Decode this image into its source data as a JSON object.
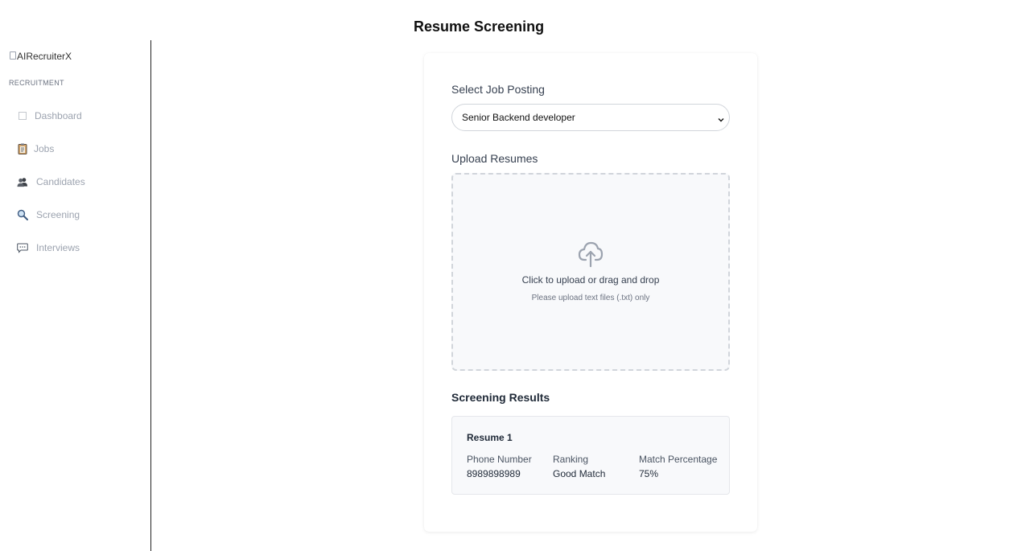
{
  "page": {
    "title": "Resume Screening"
  },
  "sidebar": {
    "logo_alt": "AIRecruiterX",
    "section_label": "RECRUITMENT",
    "items": [
      {
        "label": "Dashboard",
        "icon": "dashboard-icon"
      },
      {
        "label": "Jobs",
        "icon": "clipboard-icon"
      },
      {
        "label": "Candidates",
        "icon": "people-icon"
      },
      {
        "label": "Screening",
        "icon": "magnifier-icon"
      },
      {
        "label": "Interviews",
        "icon": "speech-bubble-icon"
      }
    ]
  },
  "form": {
    "job_label": "Select Job Posting",
    "job_selected": "Senior Backend developer",
    "upload_label": "Upload Resumes",
    "dropzone_text": "Click to upload or drag and drop",
    "dropzone_hint": "Please upload text files (.txt) only"
  },
  "results": {
    "title": "Screening Results",
    "items": [
      {
        "name": "Resume 1",
        "phone_label": "Phone Number",
        "phone": "8989898989",
        "ranking_label": "Ranking",
        "ranking": "Good Match",
        "match_label": "Match Percentage",
        "match": "75%"
      }
    ]
  },
  "colors": {
    "sidebar_text": "#9ca3af",
    "border": "#d1d5db",
    "panel_bg": "#f8f9fb"
  }
}
